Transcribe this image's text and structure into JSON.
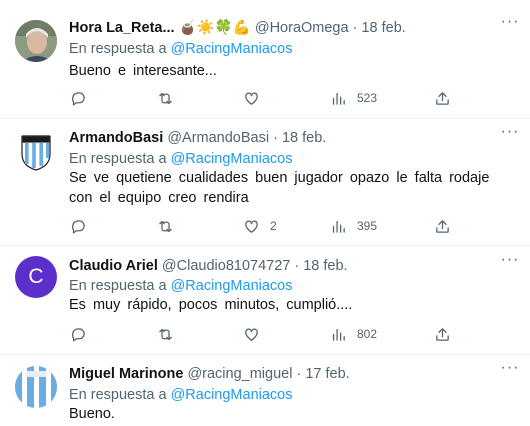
{
  "tweets": [
    {
      "name": "Hora La_Reta...",
      "emojis": "🧉☀️🍀💪",
      "handle": "@HoraOmega",
      "separator": "·",
      "date": "18 feb.",
      "reply_prefix": "En respuesta a",
      "reply_to": "@RacingManiacos",
      "text": "Bueno e interesante...",
      "replies": "",
      "retweets": "",
      "likes": "",
      "views": "523",
      "avatar": "photo"
    },
    {
      "name": "ArmandoBasi",
      "emojis": "",
      "handle": "@ArmandoBasi",
      "separator": "·",
      "date": "18 feb.",
      "reply_prefix": "En respuesta a",
      "reply_to": "@RacingManiacos",
      "text": "Se ve quetiene  cualidades  buen  jugador  opazo   le falta rodaje con el equipo  creo  rendira",
      "replies": "",
      "retweets": "",
      "likes": "2",
      "views": "395",
      "avatar": "racing-shield"
    },
    {
      "name": "Claudio Ariel",
      "emojis": "",
      "handle": "@Claudio81074727",
      "separator": "·",
      "date": "18 feb.",
      "reply_prefix": "En respuesta a",
      "reply_to": "@RacingManiacos",
      "text": "Es muy rápido, pocos minutos, cumplió....",
      "replies": "",
      "retweets": "",
      "likes": "",
      "views": "802",
      "avatar": "letter",
      "avatar_letter": "C",
      "avatar_color": "#5b2fc9"
    },
    {
      "name": "Miguel Marinone",
      "emojis": "",
      "handle": "@racing_miguel",
      "separator": "·",
      "date": "17 feb.",
      "reply_prefix": "En respuesta a",
      "reply_to": "@RacingManiacos",
      "text": "Bueno.",
      "avatar": "racing-circle"
    }
  ],
  "colors": {
    "link": "#1d9bf0",
    "muted": "#536471",
    "text": "#0f1419",
    "racing_blue": "#6cace4"
  },
  "icons": {
    "reply": "reply-icon",
    "retweet": "retweet-icon",
    "like": "heart-icon",
    "views": "views-icon",
    "share": "share-icon",
    "more": "more-icon"
  }
}
